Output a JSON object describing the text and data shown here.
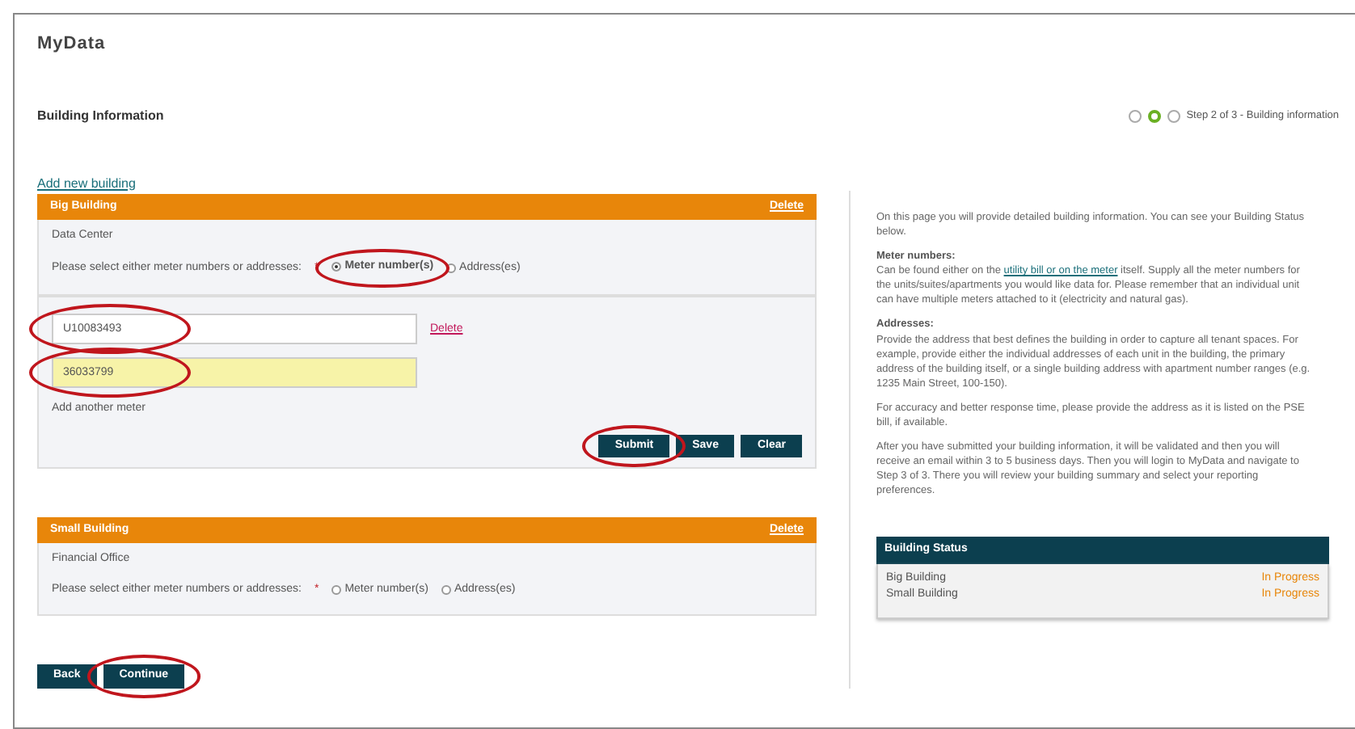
{
  "app_title": "MyData",
  "page_title": "Building Information",
  "steps": [
    {
      "selected": false
    },
    {
      "selected": true
    },
    {
      "selected": false
    }
  ],
  "step_label": "Step 2 of 3 - Building information",
  "add_building_link": "Add new building",
  "buildings": [
    {
      "name": "Big Building",
      "delete": "Delete",
      "type": "Data Center",
      "prompt": "Please select either meter numbers or addresses:",
      "required_mark": "*",
      "options": [
        {
          "label": "Meter number(s)",
          "selected": true,
          "circled": true
        },
        {
          "label": "Address(es)",
          "selected": false,
          "circled": false
        }
      ],
      "meters": [
        {
          "value": "U10083493",
          "highlighted": false,
          "circled": true,
          "delete": "Delete"
        },
        {
          "value": "36033799",
          "highlighted": true,
          "circled": true
        }
      ],
      "add_meter": "Add another meter",
      "actions": [
        {
          "label": "Submit",
          "circled": true
        },
        {
          "label": "Save",
          "circled": false
        },
        {
          "label": "Clear",
          "circled": false
        }
      ]
    },
    {
      "name": "Small Building",
      "delete": "Delete",
      "type": "Financial Office",
      "prompt": "Please select either meter numbers or addresses:",
      "required_mark": "*",
      "options": [
        {
          "label": "Meter number(s)",
          "selected": false,
          "circled": false
        },
        {
          "label": "Address(es)",
          "selected": false,
          "circled": false
        }
      ]
    }
  ],
  "nav_buttons": [
    {
      "label": "Back",
      "circled": false
    },
    {
      "label": "Continue",
      "circled": true
    }
  ],
  "help": [
    {
      "kind": "text",
      "text": "On this page you will provide detailed building information. You can see your Building Status below."
    },
    {
      "kind": "heading",
      "text": "Meter numbers:"
    },
    {
      "kind": "text",
      "before": "Can be found either on the ",
      "link": "utility bill or on the meter",
      "after": " itself. Supply all the meter numbers for the units/suites/apartments you would like data for. Please remember that an individual unit can have multiple meters attached to it (electricity and natural gas)."
    },
    {
      "kind": "heading",
      "text": "Addresses:"
    },
    {
      "kind": "text",
      "text": "Provide the address that best defines the building in order to capture all tenant spaces. For example, provide either the individual addresses of each unit in the building, the primary address of the building itself, or a single building address with apartment number ranges (e.g. 1235 Main Street, 100-150)."
    },
    {
      "kind": "text",
      "text": "For accuracy and better response time, please provide the address as it is listed on the PSE bill, if available."
    },
    {
      "kind": "text",
      "text": "After you have submitted your building information, it will be validated and then you will receive an email within 3 to 5 business days. Then you will login to MyData and navigate to Step 3 of 3. There you will review your building summary and select your reporting preferences."
    }
  ],
  "status": {
    "title": "Building Status",
    "rows": [
      {
        "name": "Big Building",
        "status": "In Progress"
      },
      {
        "name": "Small Building",
        "status": "In Progress"
      }
    ]
  }
}
